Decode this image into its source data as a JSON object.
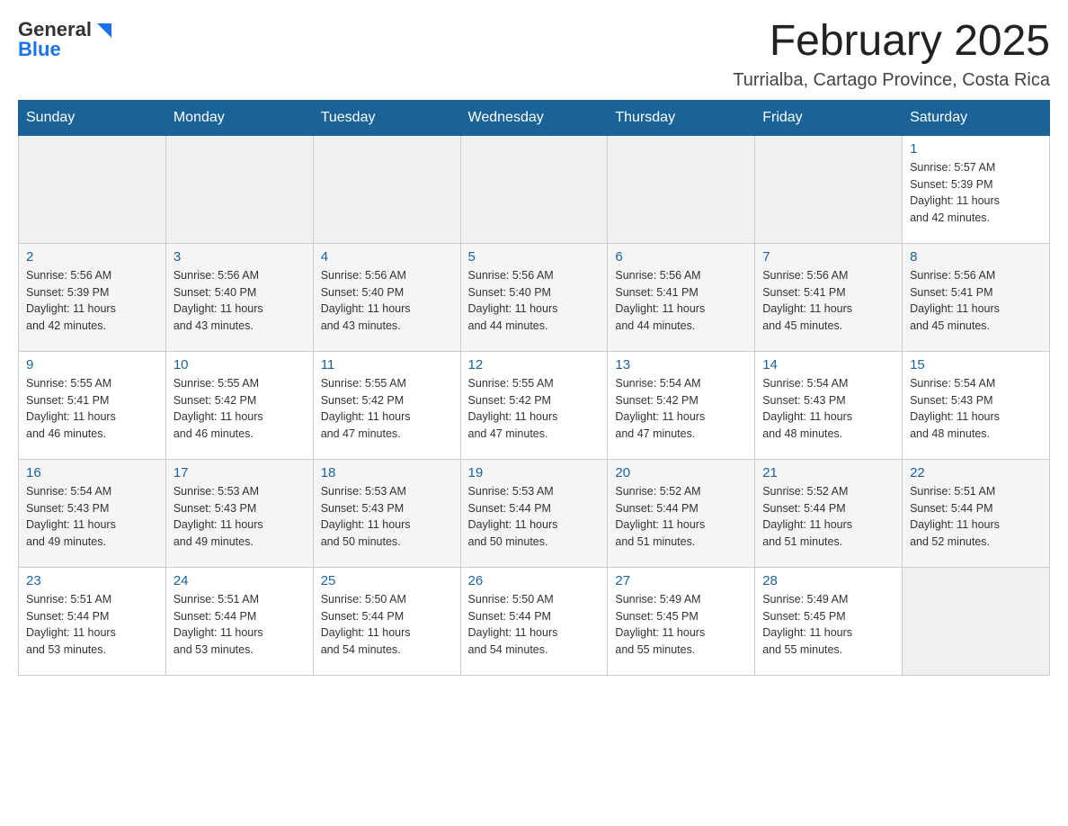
{
  "header": {
    "logo_general": "General",
    "logo_blue": "Blue",
    "month_title": "February 2025",
    "location": "Turrialba, Cartago Province, Costa Rica"
  },
  "calendar": {
    "days_of_week": [
      "Sunday",
      "Monday",
      "Tuesday",
      "Wednesday",
      "Thursday",
      "Friday",
      "Saturday"
    ],
    "weeks": [
      [
        {
          "day": "",
          "info": ""
        },
        {
          "day": "",
          "info": ""
        },
        {
          "day": "",
          "info": ""
        },
        {
          "day": "",
          "info": ""
        },
        {
          "day": "",
          "info": ""
        },
        {
          "day": "",
          "info": ""
        },
        {
          "day": "1",
          "info": "Sunrise: 5:57 AM\nSunset: 5:39 PM\nDaylight: 11 hours\nand 42 minutes."
        }
      ],
      [
        {
          "day": "2",
          "info": "Sunrise: 5:56 AM\nSunset: 5:39 PM\nDaylight: 11 hours\nand 42 minutes."
        },
        {
          "day": "3",
          "info": "Sunrise: 5:56 AM\nSunset: 5:40 PM\nDaylight: 11 hours\nand 43 minutes."
        },
        {
          "day": "4",
          "info": "Sunrise: 5:56 AM\nSunset: 5:40 PM\nDaylight: 11 hours\nand 43 minutes."
        },
        {
          "day": "5",
          "info": "Sunrise: 5:56 AM\nSunset: 5:40 PM\nDaylight: 11 hours\nand 44 minutes."
        },
        {
          "day": "6",
          "info": "Sunrise: 5:56 AM\nSunset: 5:41 PM\nDaylight: 11 hours\nand 44 minutes."
        },
        {
          "day": "7",
          "info": "Sunrise: 5:56 AM\nSunset: 5:41 PM\nDaylight: 11 hours\nand 45 minutes."
        },
        {
          "day": "8",
          "info": "Sunrise: 5:56 AM\nSunset: 5:41 PM\nDaylight: 11 hours\nand 45 minutes."
        }
      ],
      [
        {
          "day": "9",
          "info": "Sunrise: 5:55 AM\nSunset: 5:41 PM\nDaylight: 11 hours\nand 46 minutes."
        },
        {
          "day": "10",
          "info": "Sunrise: 5:55 AM\nSunset: 5:42 PM\nDaylight: 11 hours\nand 46 minutes."
        },
        {
          "day": "11",
          "info": "Sunrise: 5:55 AM\nSunset: 5:42 PM\nDaylight: 11 hours\nand 47 minutes."
        },
        {
          "day": "12",
          "info": "Sunrise: 5:55 AM\nSunset: 5:42 PM\nDaylight: 11 hours\nand 47 minutes."
        },
        {
          "day": "13",
          "info": "Sunrise: 5:54 AM\nSunset: 5:42 PM\nDaylight: 11 hours\nand 47 minutes."
        },
        {
          "day": "14",
          "info": "Sunrise: 5:54 AM\nSunset: 5:43 PM\nDaylight: 11 hours\nand 48 minutes."
        },
        {
          "day": "15",
          "info": "Sunrise: 5:54 AM\nSunset: 5:43 PM\nDaylight: 11 hours\nand 48 minutes."
        }
      ],
      [
        {
          "day": "16",
          "info": "Sunrise: 5:54 AM\nSunset: 5:43 PM\nDaylight: 11 hours\nand 49 minutes."
        },
        {
          "day": "17",
          "info": "Sunrise: 5:53 AM\nSunset: 5:43 PM\nDaylight: 11 hours\nand 49 minutes."
        },
        {
          "day": "18",
          "info": "Sunrise: 5:53 AM\nSunset: 5:43 PM\nDaylight: 11 hours\nand 50 minutes."
        },
        {
          "day": "19",
          "info": "Sunrise: 5:53 AM\nSunset: 5:44 PM\nDaylight: 11 hours\nand 50 minutes."
        },
        {
          "day": "20",
          "info": "Sunrise: 5:52 AM\nSunset: 5:44 PM\nDaylight: 11 hours\nand 51 minutes."
        },
        {
          "day": "21",
          "info": "Sunrise: 5:52 AM\nSunset: 5:44 PM\nDaylight: 11 hours\nand 51 minutes."
        },
        {
          "day": "22",
          "info": "Sunrise: 5:51 AM\nSunset: 5:44 PM\nDaylight: 11 hours\nand 52 minutes."
        }
      ],
      [
        {
          "day": "23",
          "info": "Sunrise: 5:51 AM\nSunset: 5:44 PM\nDaylight: 11 hours\nand 53 minutes."
        },
        {
          "day": "24",
          "info": "Sunrise: 5:51 AM\nSunset: 5:44 PM\nDaylight: 11 hours\nand 53 minutes."
        },
        {
          "day": "25",
          "info": "Sunrise: 5:50 AM\nSunset: 5:44 PM\nDaylight: 11 hours\nand 54 minutes."
        },
        {
          "day": "26",
          "info": "Sunrise: 5:50 AM\nSunset: 5:44 PM\nDaylight: 11 hours\nand 54 minutes."
        },
        {
          "day": "27",
          "info": "Sunrise: 5:49 AM\nSunset: 5:45 PM\nDaylight: 11 hours\nand 55 minutes."
        },
        {
          "day": "28",
          "info": "Sunrise: 5:49 AM\nSunset: 5:45 PM\nDaylight: 11 hours\nand 55 minutes."
        },
        {
          "day": "",
          "info": ""
        }
      ]
    ]
  }
}
